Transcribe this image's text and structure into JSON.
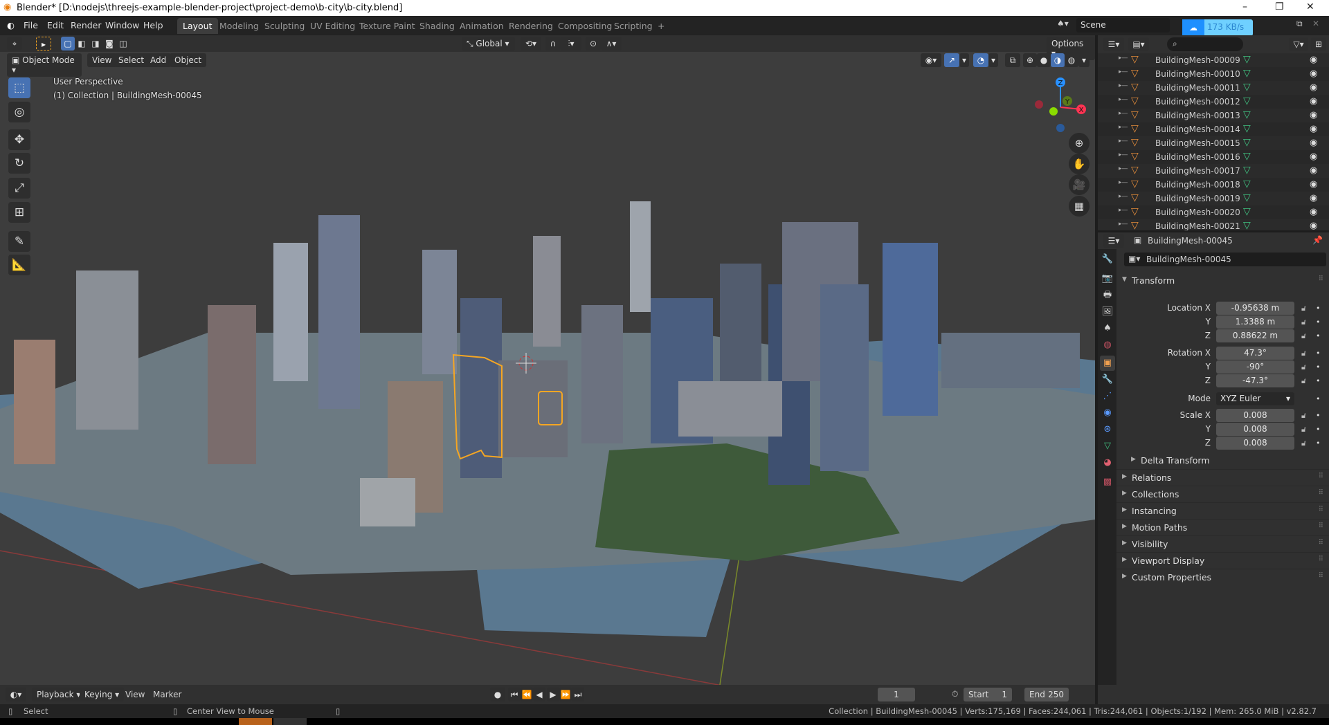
{
  "window": {
    "title": "Blender* [D:\\nodejs\\threejs-example-blender-project\\project-demo\\b-city\\b-city.blend]",
    "minimize": "–",
    "maximize": "❐",
    "close": "✕"
  },
  "menu": [
    "File",
    "Edit",
    "Render",
    "Window",
    "Help"
  ],
  "workspaces": [
    "Layout",
    "Modeling",
    "Sculpting",
    "UV Editing",
    "Texture Paint",
    "Shading",
    "Animation",
    "Rendering",
    "Compositing",
    "Scripting",
    "+"
  ],
  "active_workspace": "Layout",
  "scene": {
    "name": "Scene",
    "net_speed": "173 KB/s"
  },
  "viewport": {
    "orientation": "Global",
    "options": "Options",
    "mode": "Object Mode",
    "header_menu": [
      "View",
      "Select",
      "Add",
      "Object"
    ],
    "overlay_title": "User Perspective",
    "overlay_subtitle": "(1) Collection | BuildingMesh-00045",
    "gizmo": {
      "z": "Z",
      "y": "Y",
      "x": "X"
    },
    "axis_colors": {
      "x": "#ff3352",
      "y": "#8bdc00",
      "z": "#2890ff"
    }
  },
  "outliner": {
    "items": [
      "BuildingMesh-00009",
      "BuildingMesh-00010",
      "BuildingMesh-00011",
      "BuildingMesh-00012",
      "BuildingMesh-00013",
      "BuildingMesh-00014",
      "BuildingMesh-00015",
      "BuildingMesh-00016",
      "BuildingMesh-00017",
      "BuildingMesh-00018",
      "BuildingMesh-00019",
      "BuildingMesh-00020",
      "BuildingMesh-00021"
    ]
  },
  "properties": {
    "header_object": "BuildingMesh-00045",
    "object_name": "BuildingMesh-00045",
    "transform_label": "Transform",
    "location": {
      "label": "Location X",
      "x": "-0.95638 m",
      "y": "1.3388 m",
      "z": "0.88622 m"
    },
    "rotation": {
      "label": "Rotation X",
      "x": "47.3°",
      "y": "-90°",
      "z": "-47.3°"
    },
    "mode": {
      "label": "Mode",
      "value": "XYZ Euler"
    },
    "scale": {
      "label": "Scale X",
      "x": "0.008",
      "y": "0.008",
      "z": "0.008"
    },
    "axis_y": "Y",
    "axis_z": "Z",
    "delta": "Delta Transform",
    "sections": [
      "Relations",
      "Collections",
      "Instancing",
      "Motion Paths",
      "Visibility",
      "Viewport Display",
      "Custom Properties"
    ]
  },
  "timeline": {
    "menus": [
      "Playback",
      "Keying",
      "View",
      "Marker"
    ],
    "current_frame": "1",
    "start_label": "Start",
    "start": "1",
    "end_label": "End",
    "end": "250"
  },
  "status": {
    "left": "Select",
    "middle": "Center View to Mouse",
    "stats": "Collection | BuildingMesh-00045 | Verts:175,169 | Faces:244,061 | Tris:244,061 | Objects:1/192 | Mem: 265.0 MiB | v2.82.7"
  },
  "colors": {
    "accent": "#4772b3",
    "selection": "#f5a623",
    "mesh": "#e08a3a",
    "data": "#3fbf7f"
  }
}
